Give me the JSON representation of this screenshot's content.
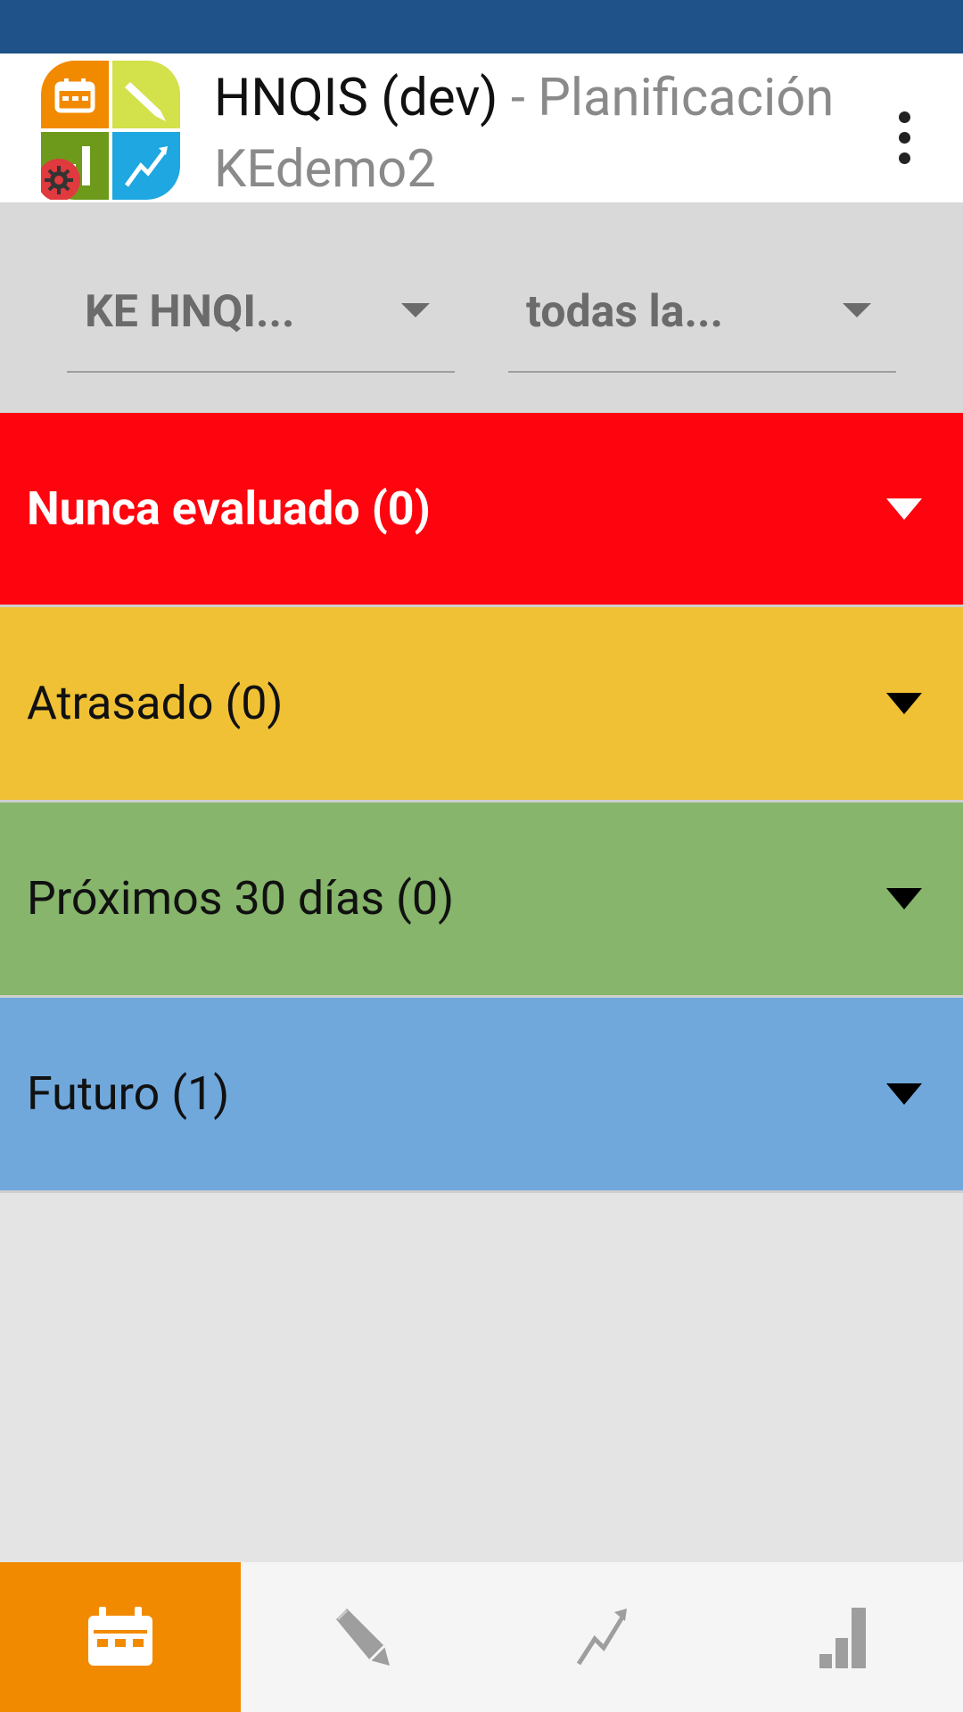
{
  "app": {
    "name": "HNQIS (dev)",
    "section": " - Planificación",
    "user": "KEdemo2"
  },
  "filters": {
    "program": "KE HNQI...",
    "org_unit": "todas la..."
  },
  "groups": [
    {
      "label": "Nunca evaluado (0)",
      "color": "#fe040e",
      "text_color": "#ffffff",
      "bold": true
    },
    {
      "label": "Atrasado (0)",
      "color": "#f0c134",
      "text_color": "#111111",
      "bold": false
    },
    {
      "label": "Próximos 30 días (0)",
      "color": "#86b56b",
      "text_color": "#111111",
      "bold": false
    },
    {
      "label": "Futuro (1)",
      "color": "#70a8dc",
      "text_color": "#111111",
      "bold": false
    }
  ],
  "nav": {
    "active_color": "#f28a00",
    "tabs": [
      {
        "icon": "calendar-icon",
        "active": true
      },
      {
        "icon": "pencil-icon",
        "active": false
      },
      {
        "icon": "trend-icon",
        "active": false
      },
      {
        "icon": "bar-chart-icon",
        "active": false
      }
    ]
  },
  "colors": {
    "status_bar": "#1e5289",
    "logo_orange": "#f28a00",
    "logo_lime": "#d3e14b",
    "logo_green": "#6d9a1a",
    "logo_blue": "#1ea7e1",
    "logo_badge": "#e0393e"
  }
}
